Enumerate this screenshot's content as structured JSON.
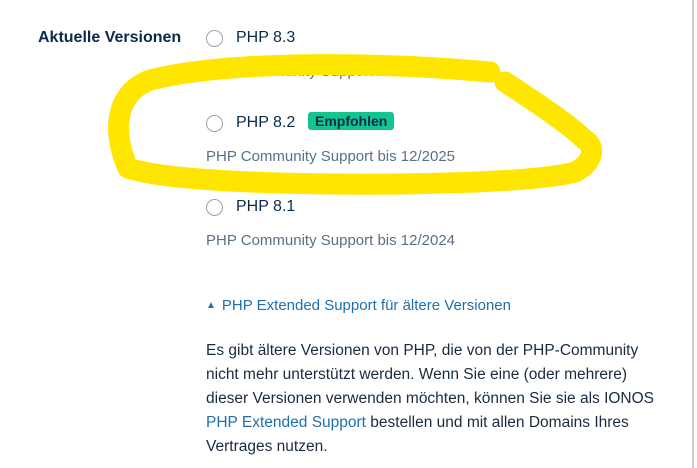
{
  "section": {
    "label": "Aktuelle Versionen"
  },
  "options": [
    {
      "label": "PHP 8.3",
      "support": "PHP Community Support bis 12/2026"
    },
    {
      "label": "PHP 8.2",
      "badge": "Empfohlen",
      "support": "PHP Community Support bis 12/2025"
    },
    {
      "label": "PHP 8.1",
      "support": "PHP Community Support bis 12/2024"
    }
  ],
  "extended": {
    "toggle_label": "PHP Extended Support für ältere Versionen",
    "description_part1": "Es gibt ältere Versionen von PHP, die von der PHP-Community nicht mehr unterstützt werden. Wenn Sie eine (oder mehrere) dieser Versionen verwenden möchten, können Sie sie als IONOS ",
    "description_link": "PHP Extended Support",
    "description_part2": " bestellen und mit allen Domains Ihres Vertrages nutzen."
  },
  "colors": {
    "accent": "#1f6fae",
    "badge": "#12c48f",
    "highlight": "#ffe600",
    "text": "#0b2a4a",
    "muted": "#5c6f85"
  },
  "icons": {
    "toggle": "chevron-up-icon"
  }
}
